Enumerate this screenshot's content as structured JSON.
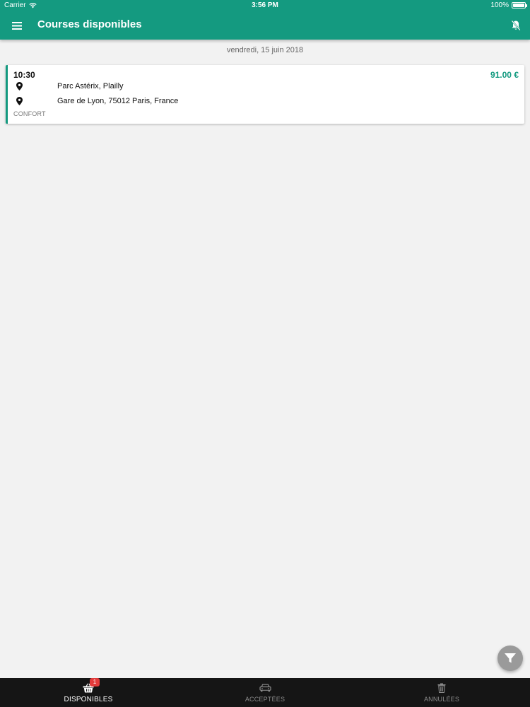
{
  "status_bar": {
    "carrier": "Carrier",
    "time": "3:56 PM",
    "battery": "100%"
  },
  "header": {
    "title": "Courses disponibles",
    "menu_icon": "hamburger-menu-icon",
    "notification_icon": "bell-off-icon"
  },
  "rides": {
    "date": "vendredi, 15 juin 2018",
    "items": [
      {
        "time": "10:30",
        "price": "91.00 €",
        "pickup": "Parc Astérix, Plailly",
        "dropoff": "Gare de Lyon, 75012 Paris, France",
        "category": "CONFORT"
      }
    ]
  },
  "fab": {
    "icon": "filter-icon"
  },
  "tabs": [
    {
      "label": "DISPONIBLES",
      "icon": "basket-icon",
      "badge": "1",
      "active": true
    },
    {
      "label": "ACCEPTÉES",
      "icon": "car-icon",
      "active": false
    },
    {
      "label": "ANNULÉES",
      "icon": "trash-icon",
      "active": false
    }
  ],
  "colors": {
    "primary": "#149a80",
    "background": "#f2f2f2",
    "tabbar": "#151515",
    "badge": "#e23a3a",
    "fab": "#9a9a9a"
  }
}
